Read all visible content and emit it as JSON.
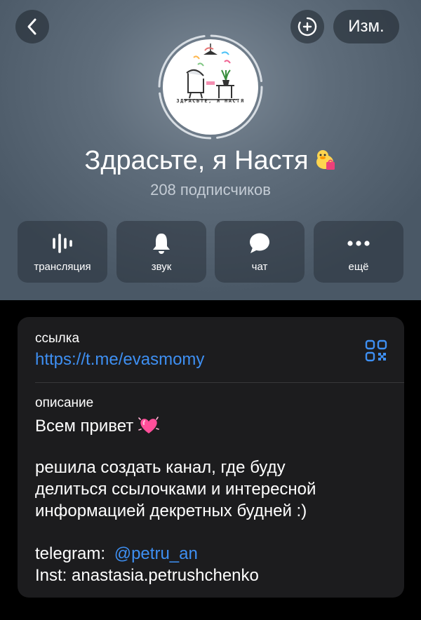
{
  "nav": {
    "back_icon": "chevron-left-icon",
    "add_icon": "add-circle-icon",
    "edit_label": "Изм."
  },
  "channel": {
    "name": "Здрасьте, я Настя",
    "emoji_icon": "duck-with-gift-emoji",
    "subscribers": "208 подписчиков",
    "avatar_caption": "ЗДРАСЬТЕ, Я НАСТЯ"
  },
  "actions": [
    {
      "label": "трансляция",
      "icon": "live-stream-icon"
    },
    {
      "label": "звук",
      "icon": "bell-icon"
    },
    {
      "label": "чат",
      "icon": "chat-bubble-icon"
    },
    {
      "label": "ещё",
      "icon": "more-dots-icon"
    }
  ],
  "info": {
    "link_label": "ссылка",
    "link_value": "https://t.me/evasmomy",
    "qr_icon": "qr-code-icon",
    "description_label": "описание",
    "description_greeting": "Всем привет",
    "greeting_emoji": "sparkling-heart-emoji",
    "description_lines": [
      "решила создать канал, где буду",
      "делиться ссылочками и интересной",
      "информацией декретных будней :)"
    ],
    "telegram_prefix": "telegram:",
    "telegram_handle": "@petru_an",
    "inst_line": "Inst: anastasia.petrushchenko"
  },
  "colors": {
    "accent": "#3e8ff2",
    "card_background": "#1c1c1e",
    "header_background": "#5f6d7b"
  }
}
